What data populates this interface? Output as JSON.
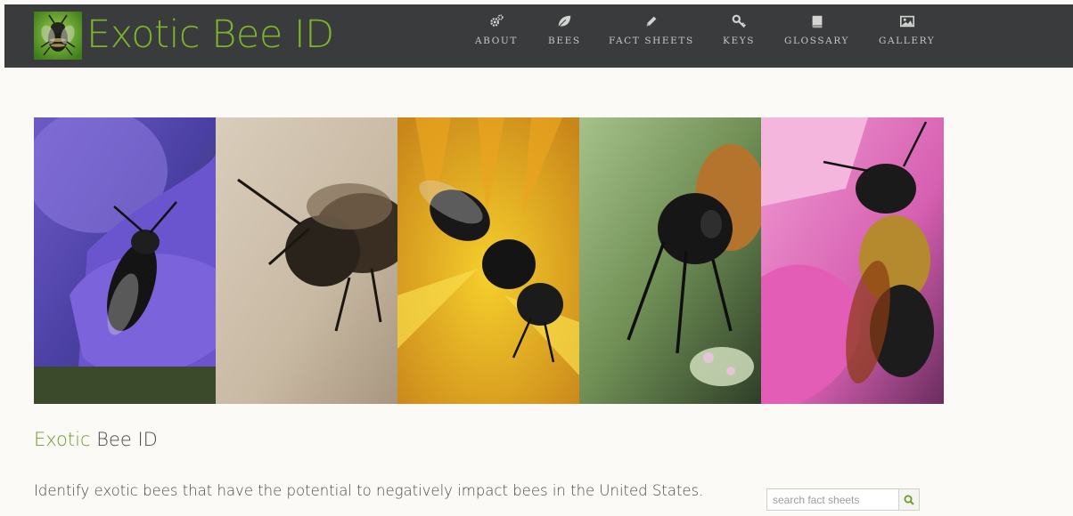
{
  "site": {
    "title": "Exotic Bee ID",
    "logo_icon": "bee-logo-icon",
    "brand_color": "#7db32a",
    "header_bg": "#3a3b3d"
  },
  "nav": {
    "items": [
      {
        "label": "ABOUT",
        "icon": "cogs-icon"
      },
      {
        "label": "BEES",
        "icon": "leaf-icon"
      },
      {
        "label": "FACT SHEETS",
        "icon": "pencil-icon"
      },
      {
        "label": "KEYS",
        "icon": "key-icon"
      },
      {
        "label": "GLOSSARY",
        "icon": "book-icon"
      },
      {
        "label": "GALLERY",
        "icon": "image-icon"
      }
    ]
  },
  "banner": {
    "panels": [
      {
        "name": "bee-on-purple-flower-photo"
      },
      {
        "name": "bee-on-stone-photo"
      },
      {
        "name": "bee-on-yellow-flower-photo"
      },
      {
        "name": "bee-on-green-leaf-photo"
      },
      {
        "name": "bee-on-pink-flower-photo"
      }
    ]
  },
  "content": {
    "heading_accent": "Exotic",
    "heading_rest": " Bee ID",
    "intro": "Identify exotic bees that have the potential to negatively impact bees in the United States."
  },
  "search": {
    "placeholder": "search fact sheets",
    "value": "",
    "button_icon": "search-icon"
  }
}
